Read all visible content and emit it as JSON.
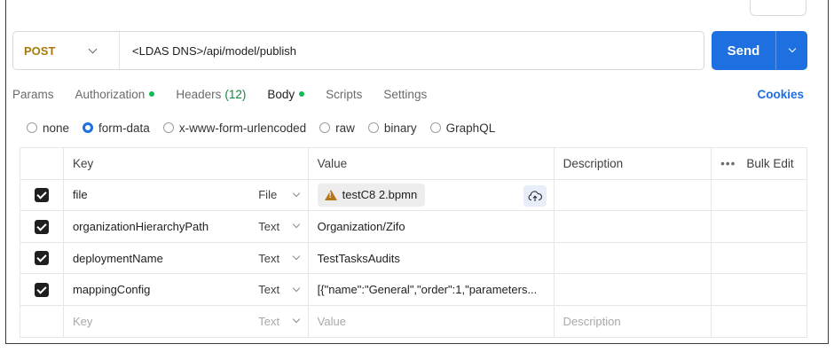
{
  "request": {
    "method": "POST",
    "url": "<LDAS DNS>/api/model/publish",
    "send_label": "Send"
  },
  "tabs": [
    {
      "label": "Params"
    },
    {
      "label": "Authorization",
      "dot": true
    },
    {
      "label": "Headers",
      "count": "(12)"
    },
    {
      "label": "Body",
      "dot": true,
      "active": true
    },
    {
      "label": "Scripts"
    },
    {
      "label": "Settings"
    }
  ],
  "cookies_label": "Cookies",
  "body_types": [
    {
      "label": "none",
      "selected": false
    },
    {
      "label": "form-data",
      "selected": true
    },
    {
      "label": "x-www-form-urlencoded",
      "selected": false
    },
    {
      "label": "raw",
      "selected": false
    },
    {
      "label": "binary",
      "selected": false
    },
    {
      "label": "GraphQL",
      "selected": false
    }
  ],
  "table": {
    "headers": {
      "key": "Key",
      "value": "Value",
      "description": "Description",
      "bulk_edit": "Bulk Edit"
    },
    "rows": [
      {
        "key": "file",
        "type": "File",
        "value": "testC8 2.bpmn",
        "is_file": true,
        "checked": true
      },
      {
        "key": "organizationHierarchyPath",
        "type": "Text",
        "value": "Organization/Zifo",
        "checked": true
      },
      {
        "key": "deploymentName",
        "type": "Text",
        "value": "TestTasksAudits",
        "checked": true
      },
      {
        "key": "mappingConfig",
        "type": "Text",
        "value": "[{\"name\":\"General\",\"order\":1,\"parameters...",
        "checked": true
      }
    ],
    "placeholder": {
      "key": "Key",
      "type": "Text",
      "value": "Value",
      "description": "Description"
    }
  },
  "colors": {
    "accent": "#1e6fe0",
    "method": "#a7790a",
    "dot": "#0cbb52"
  }
}
